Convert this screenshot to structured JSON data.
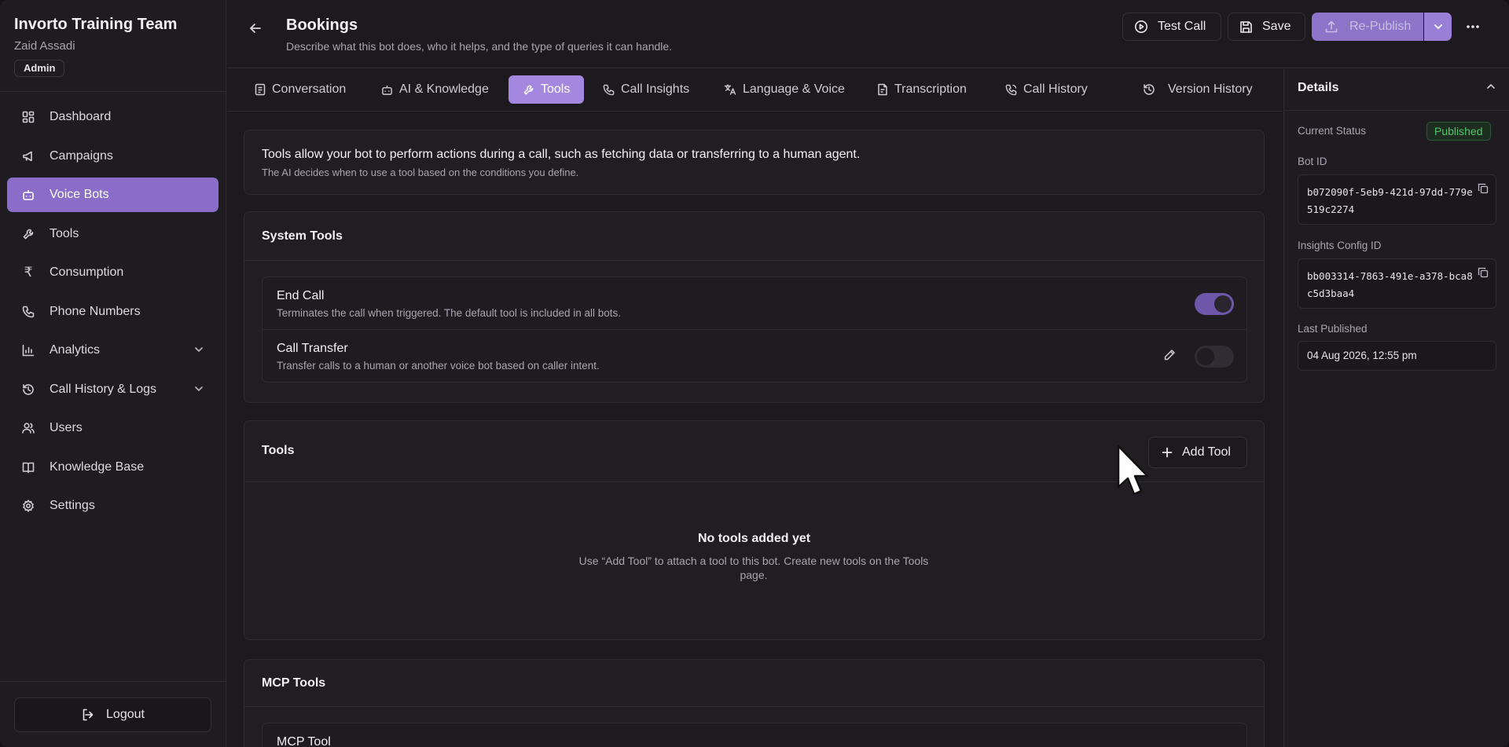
{
  "sidebar": {
    "team_name": "Invorto Training Team",
    "user_name": "Zaid Assadi",
    "role": "Admin",
    "items": [
      {
        "label": "Dashboard",
        "icon": "grid-icon"
      },
      {
        "label": "Campaigns",
        "icon": "megaphone-icon"
      },
      {
        "label": "Voice Bots",
        "icon": "bot-icon",
        "active": true
      },
      {
        "label": "Tools",
        "icon": "wrench-icon"
      },
      {
        "label": "Consumption",
        "icon": "rupee-icon"
      },
      {
        "label": "Phone Numbers",
        "icon": "phone-icon"
      },
      {
        "label": "Analytics",
        "icon": "bar-chart-icon",
        "expandable": true
      },
      {
        "label": "Call History & Logs",
        "icon": "history-icon",
        "expandable": true
      },
      {
        "label": "Users",
        "icon": "users-icon"
      },
      {
        "label": "Knowledge Base",
        "icon": "book-icon"
      },
      {
        "label": "Settings",
        "icon": "gear-icon"
      }
    ],
    "logout": "Logout"
  },
  "header": {
    "title": "Bookings",
    "description": "Describe what this bot does, who it helps, and the type of queries it can handle.",
    "test_call": "Test Call",
    "save": "Save",
    "republish": "Re-Publish"
  },
  "tabs": [
    {
      "label": "Conversation",
      "icon": "document-icon"
    },
    {
      "label": "AI & Knowledge",
      "icon": "bot-icon"
    },
    {
      "label": "Tools",
      "icon": "wrench-icon",
      "active": true
    },
    {
      "label": "Call Insights",
      "icon": "phone-icon"
    },
    {
      "label": "Language & Voice",
      "icon": "translate-icon"
    },
    {
      "label": "Transcription",
      "icon": "transcript-icon"
    },
    {
      "label": "Call History",
      "icon": "phone-history-icon"
    },
    {
      "label": "Version History",
      "icon": "history-icon"
    }
  ],
  "main": {
    "info_title": "Tools allow your bot to perform actions during a call, such as fetching data or transferring to a human agent.",
    "info_sub": "The AI decides when to use a tool based on the conditions you define.",
    "system_tools": {
      "title": "System Tools",
      "items": [
        {
          "name": "End Call",
          "description": "Terminates the call when triggered. The default tool is included in all bots.",
          "enabled": true
        },
        {
          "name": "Call Transfer",
          "description": "Transfer calls to a human or another voice bot based on caller intent.",
          "enabled": false
        }
      ]
    },
    "tools": {
      "title": "Tools",
      "add_label": "Add Tool",
      "empty_title": "No tools added yet",
      "empty_desc": "Use “Add Tool” to attach a tool to this bot. Create new tools on the Tools page."
    },
    "mcp": {
      "title": "MCP Tools",
      "item_name": "MCP Tool"
    }
  },
  "details": {
    "title": "Details",
    "status_label": "Current Status",
    "status": "Published",
    "bot_id_label": "Bot ID",
    "bot_id": "b072090f-5eb9-421d-97dd-779e519c2274",
    "insights_label": "Insights Config ID",
    "insights_id": "bb003314-7863-491e-a378-bca8c5d3baa4",
    "last_published_label": "Last Published",
    "last_published": "04 Aug 2026, 12:55 pm"
  },
  "colors": {
    "accent": "#8a6cc9",
    "tab_active": "#a488e0",
    "status_green": "#52c46a",
    "background": "#1c1a1f"
  }
}
